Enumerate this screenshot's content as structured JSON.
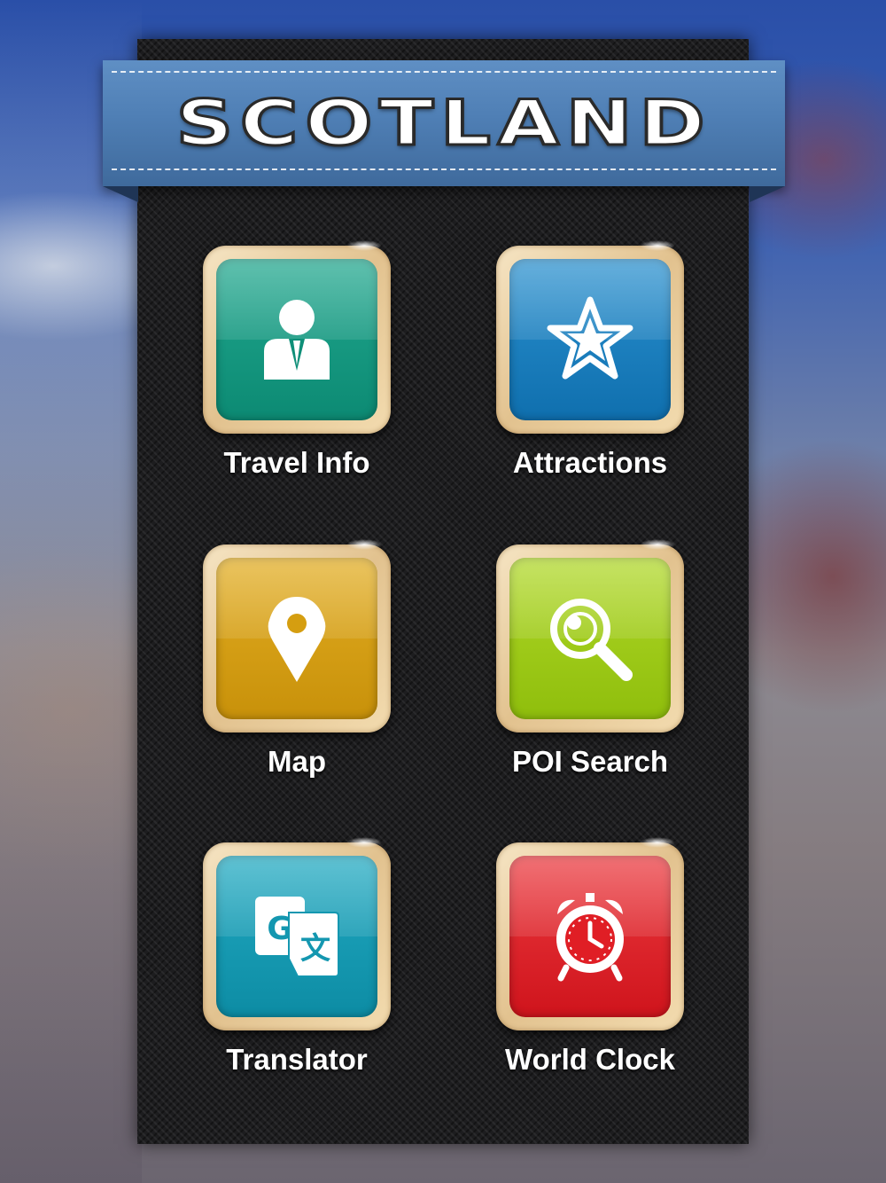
{
  "header": {
    "title": "SCOTLAND"
  },
  "menu": {
    "items": [
      {
        "label": "Travel Info",
        "icon": "person-icon",
        "color": "#10917c"
      },
      {
        "label": "Attractions",
        "icon": "star-icon",
        "color": "#1477b8"
      },
      {
        "label": "Map",
        "icon": "map-pin-icon",
        "color": "#d59e10"
      },
      {
        "label": "POI Search",
        "icon": "search-icon",
        "color": "#9ccb12"
      },
      {
        "label": "Translator",
        "icon": "translate-icon",
        "color": "#1497b0"
      },
      {
        "label": "World Clock",
        "icon": "alarm-clock-icon",
        "color": "#e01e25"
      }
    ]
  }
}
